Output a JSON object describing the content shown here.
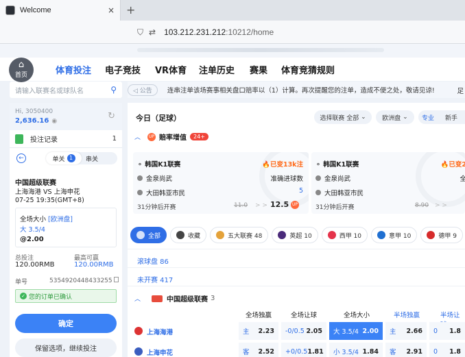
{
  "browser": {
    "tab_title": "Welcome",
    "close_glyph": "×",
    "newtab_glyph": "+",
    "url_host": "103.212.231.212",
    "url_rest": ":10212/home"
  },
  "nav": {
    "home_label": "首页",
    "items": [
      "体育投注",
      "电子竞技",
      "VR体育",
      "注单历史",
      "赛果",
      "体育竞猜规则"
    ]
  },
  "search": {
    "placeholder": "请输入联赛名或球队名"
  },
  "account": {
    "greeting": "Hi, 3050400",
    "balance": "2,636.16"
  },
  "records": {
    "label": "投注记录",
    "count": "1"
  },
  "slip": {
    "tab_single": "单关",
    "tab_single_count": "1",
    "tab_parlay": "串关",
    "league": "中国超级联赛",
    "teams": "上海海港 VS 上海申花",
    "time": "07-25 19:35(GMT+8)",
    "market": "全场大小",
    "market_type": "[欧洲盘]",
    "pick": "大 3.5/4",
    "odds": "@2.00",
    "stake_label": "总投注",
    "stake_value": "120.00RMB",
    "max_label": "最高可赢",
    "max_value": "120.00RMB",
    "ticket_label": "单号",
    "ticket_value": "5354920448433255",
    "confirmed": "您的订单已确认",
    "confirm_btn": "确定",
    "keep_btn": "保留选项，继续投注"
  },
  "notice": {
    "tag": "公告",
    "text": "连串注单该场赛事相关盘口赔率以（1）计算。再次提醒您的注单，造成不便之处，敬请见谅!",
    "tail": "足"
  },
  "main": {
    "title": "今日（足球）",
    "select_league": "选择联赛  全部",
    "select_disc": "欧洲盘",
    "pro": "专业",
    "newbie": "新手",
    "boost_label": "赔率增值",
    "boost_count": "24+",
    "cards": [
      {
        "league": "韩国K1联赛",
        "badge": "已变13k注",
        "home": "金泉尚武",
        "away": "大田韩亚市民",
        "market1": "准确进球数",
        "market2": "5",
        "start": "31分钟后开赛",
        "old": "11.0",
        "new": "12.5"
      },
      {
        "league": "韩国K1联赛",
        "badge": "已变2",
        "home": "金泉尚武",
        "away": "大田韩亚市民",
        "market1": "全",
        "market2": "",
        "start": "31分钟后开赛",
        "old": "8.90",
        "new": ""
      }
    ],
    "filters": [
      "全部",
      "收藏",
      "五大联赛 48",
      "英超 10",
      "西甲 10",
      "意甲 10",
      "德甲 9"
    ],
    "inplay": "滚球盘 86",
    "upcoming": "未开赛 417",
    "league_name": "中国超级联赛",
    "league_count": "3",
    "col_headers": [
      "全场独赢",
      "全场让球",
      "全场大小",
      "半场独赢",
      "半场让球"
    ],
    "rows": [
      {
        "team": "上海海港",
        "win_lbl": "主",
        "win": "2.23",
        "hcp_lbl": "-0/0.5",
        "hcp": "2.05",
        "ou_lbl": "大 3.5/4",
        "ou": "2.00",
        "hwin_lbl": "主",
        "hwin": "2.66",
        "hhcp_lbl": "0",
        "hhcp": "1.8"
      },
      {
        "team": "上海申花",
        "win_lbl": "客",
        "win": "2.52",
        "hcp_lbl": "+0/0.5",
        "hcp": "1.81",
        "ou_lbl": "小 3.5/4",
        "ou": "1.84",
        "hwin_lbl": "客",
        "hwin": "2.91",
        "hhcp_lbl": "0",
        "hhcp": "1.8"
      }
    ]
  },
  "colors": {
    "accent": "#2f6ee6",
    "boost": "#f0453a",
    "confirm_bg": "#e9f7ea"
  }
}
